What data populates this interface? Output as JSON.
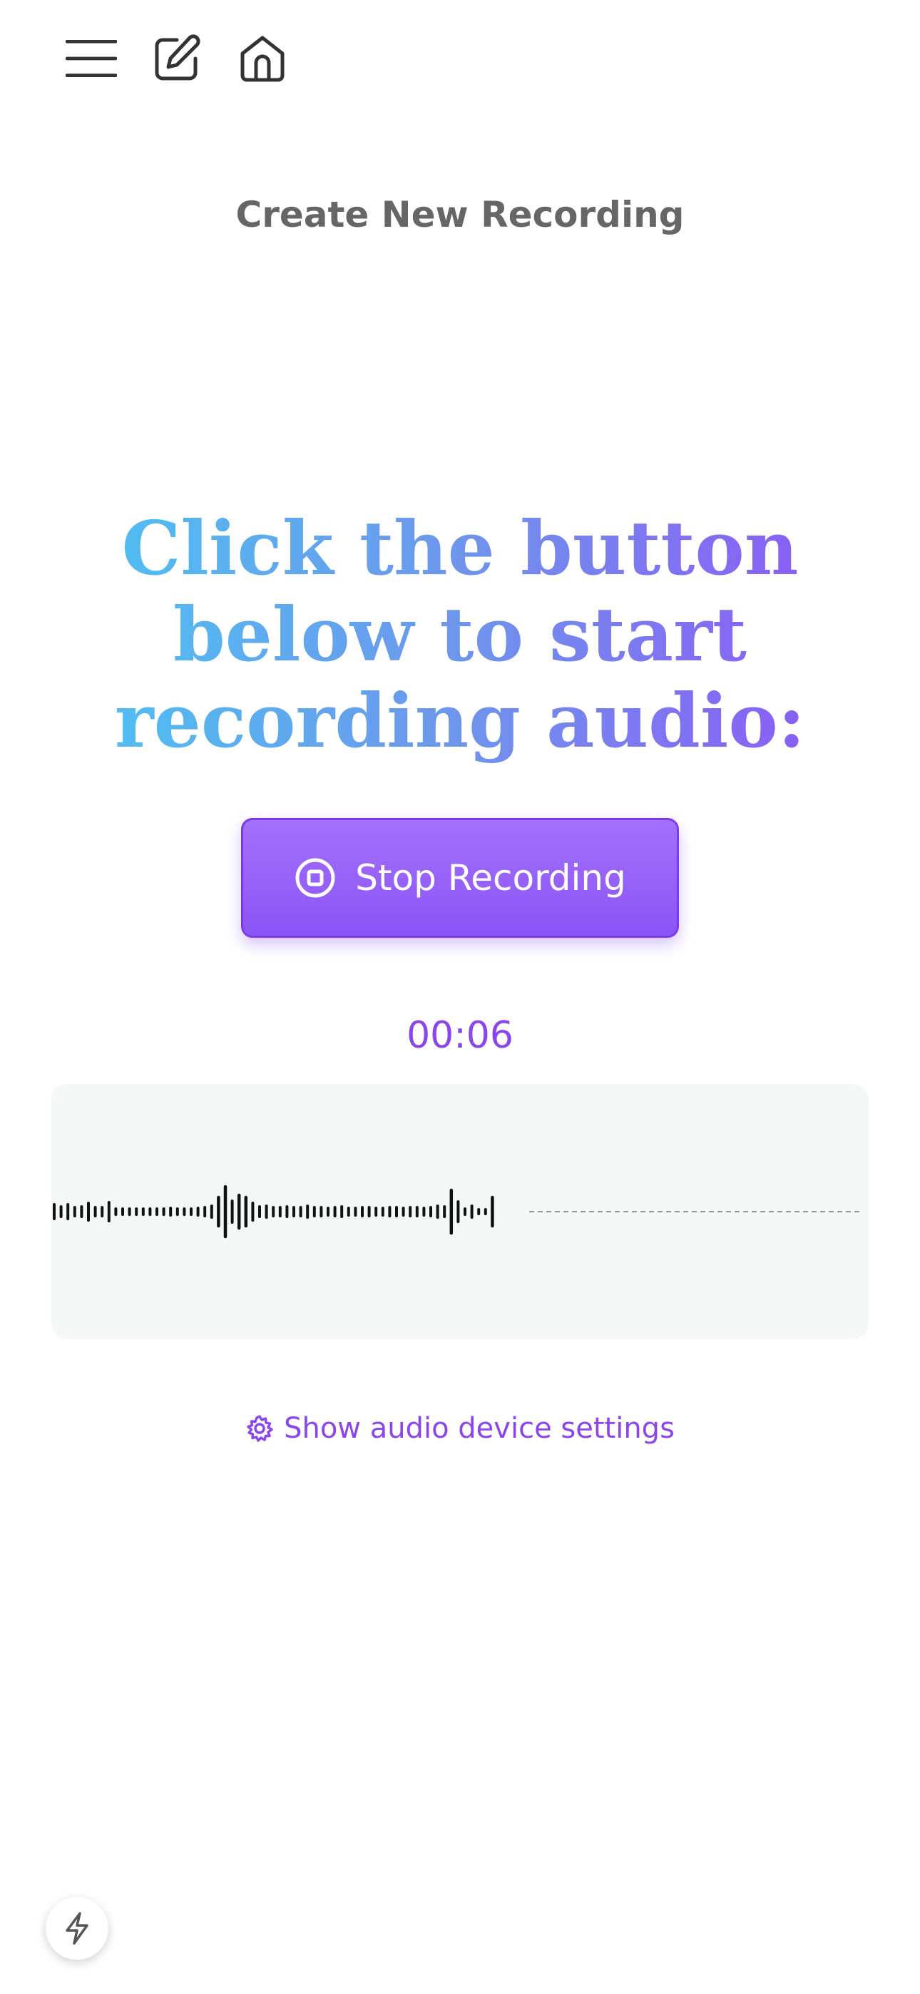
{
  "header": {
    "title": "Create New Recording",
    "icons": [
      "menu-icon",
      "edit-icon",
      "home-icon"
    ]
  },
  "prompt": {
    "line1": "Click the button",
    "line2": "below to start",
    "line3": "recording audio:"
  },
  "recorder": {
    "stop_label": "Stop Recording",
    "stop_icon": "stop-circle-icon",
    "elapsed": "00:06"
  },
  "settings": {
    "label": "Show audio device settings",
    "icon": "gear-icon"
  },
  "fab": {
    "icon": "bolt-icon"
  },
  "colors": {
    "accent": "#8b5cf6",
    "accent_text": "#8b45ee",
    "title_gray": "#666666",
    "gradient_start": "#4fbff2",
    "gradient_end": "#8b5cf6",
    "waveform_bg": "#f4f9f8"
  }
}
